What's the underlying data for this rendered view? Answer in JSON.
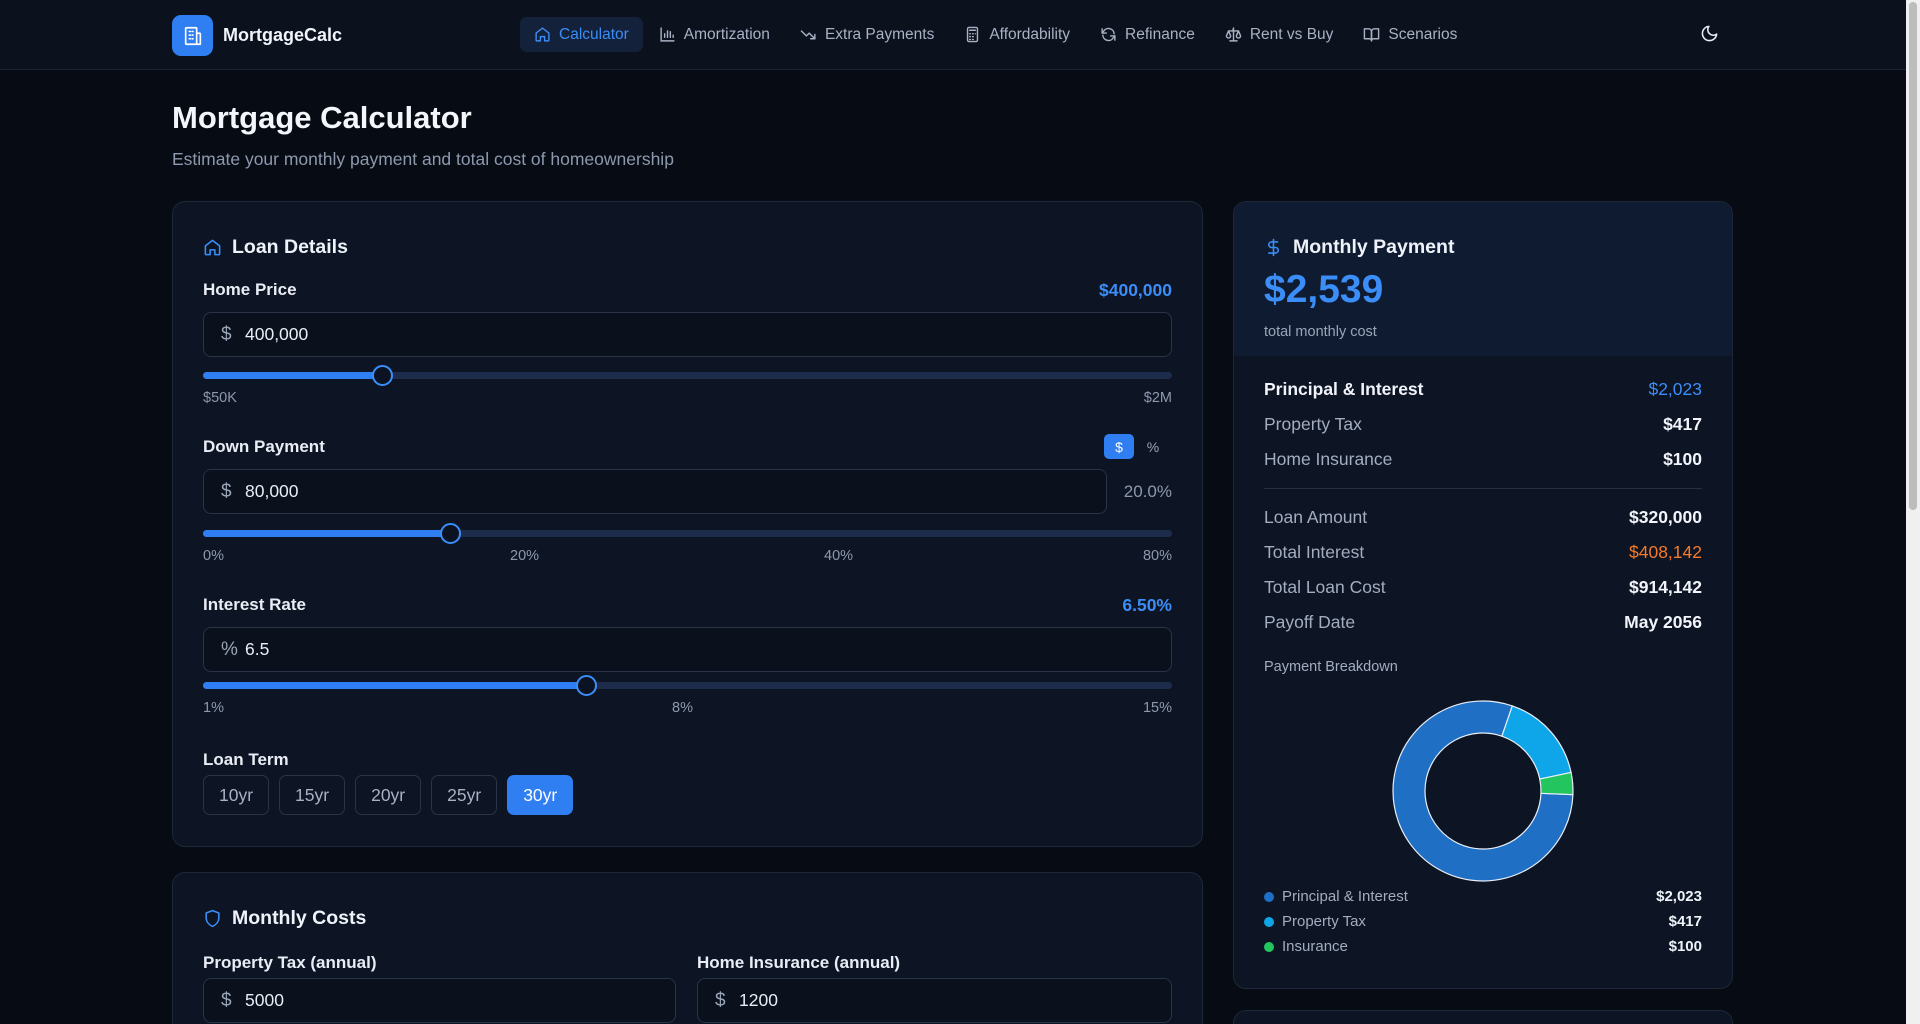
{
  "brand": {
    "name": "MortgageCalc"
  },
  "nav": {
    "items": [
      {
        "label": "Calculator",
        "icon": "home-icon",
        "active": true
      },
      {
        "label": "Amortization",
        "icon": "bar-chart-icon"
      },
      {
        "label": "Extra Payments",
        "icon": "trending-down-icon"
      },
      {
        "label": "Affordability",
        "icon": "calculator-icon"
      },
      {
        "label": "Refinance",
        "icon": "refresh-icon"
      },
      {
        "label": "Rent vs Buy",
        "icon": "scale-icon"
      },
      {
        "label": "Scenarios",
        "icon": "book-icon"
      }
    ]
  },
  "page": {
    "title": "Mortgage Calculator",
    "subtitle": "Estimate your monthly payment and total cost of homeownership"
  },
  "loan": {
    "title": "Loan Details",
    "home_price": {
      "label": "Home Price",
      "display": "$400,000",
      "prefix": "$",
      "value": "400,000",
      "slider_fraction": 0.185,
      "min_label": "$50K",
      "max_label": "$2M"
    },
    "down_payment": {
      "label": "Down Payment",
      "toggle": [
        "$",
        "%"
      ],
      "prefix": "$",
      "value": "80,000",
      "percent_display": "20.0%",
      "slider_fraction": 0.255,
      "ticks": [
        "0%",
        "20%",
        "40%",
        "80%"
      ]
    },
    "interest": {
      "label": "Interest Rate",
      "display": "6.50%",
      "prefix": "%",
      "value": "6.5",
      "slider_fraction": 0.395,
      "ticks": [
        "1%",
        "8%",
        "15%"
      ]
    },
    "term": {
      "label": "Loan Term",
      "options": [
        "10yr",
        "15yr",
        "20yr",
        "25yr",
        "30yr"
      ],
      "selected": "30yr"
    }
  },
  "costs": {
    "title": "Monthly Costs",
    "property_tax": {
      "label": "Property Tax (annual)",
      "prefix": "$",
      "value": "5000"
    },
    "insurance": {
      "label": "Home Insurance (annual)",
      "prefix": "$",
      "value": "1200"
    }
  },
  "monthly": {
    "title": "Monthly Payment",
    "amount": "$2,539",
    "caption": "total monthly cost",
    "breakdown": [
      {
        "label": "Principal & Interest",
        "value": "$2,023"
      },
      {
        "label": "Property Tax",
        "value": "$417"
      },
      {
        "label": "Home Insurance",
        "value": "$100"
      }
    ],
    "totals": [
      {
        "label": "Loan Amount",
        "value": "$320,000"
      },
      {
        "label": "Total Interest",
        "value": "$408,142"
      },
      {
        "label": "Total Loan Cost",
        "value": "$914,142"
      },
      {
        "label": "Payoff Date",
        "value": "May 2056"
      }
    ],
    "chart_title": "Payment Breakdown"
  },
  "chart_data": {
    "type": "pie",
    "title": "Payment Breakdown",
    "categories": [
      "Principal & Interest",
      "Property Tax",
      "Insurance"
    ],
    "values": [
      2023,
      417,
      100
    ],
    "value_labels": [
      "$2,023",
      "$417",
      "$100"
    ],
    "colors": [
      "#1f6fc4",
      "#0ea5e9",
      "#22c55e"
    ],
    "donut": true,
    "legend": "bottom"
  },
  "colors": {
    "accent": "#2f7ef2",
    "background": "#070b14",
    "card": "#0d1423",
    "orange": "#f47a2a"
  }
}
